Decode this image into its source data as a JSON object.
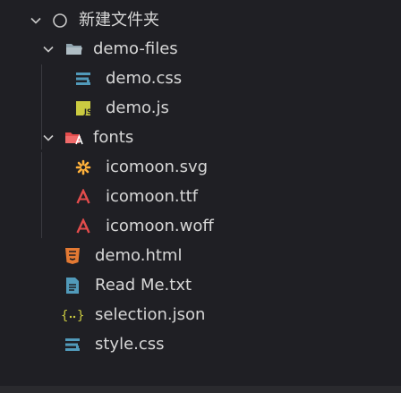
{
  "explorer": {
    "root": {
      "label": "新建文件夹"
    },
    "items": [
      {
        "label": "demo-files"
      },
      {
        "label": "demo.css"
      },
      {
        "label": "demo.js"
      },
      {
        "label": "fonts"
      },
      {
        "label": "icomoon.svg"
      },
      {
        "label": "icomoon.ttf"
      },
      {
        "label": "icomoon.woff"
      },
      {
        "label": "demo.html"
      },
      {
        "label": "Read Me.txt"
      },
      {
        "label": "selection.json"
      },
      {
        "label": "style.css"
      }
    ]
  },
  "icons": {
    "root": "circle-outline-icon",
    "folder_open": "folder-open-icon",
    "folder_fonts": "fonts-folder-icon",
    "css": "css-file-icon",
    "js": "js-file-icon",
    "svg": "svg-file-icon",
    "font": "font-file-icon",
    "html": "html-file-icon",
    "txt": "text-file-icon",
    "json": "json-file-icon"
  },
  "colors": {
    "background": "#1f1f24",
    "text": "#d7d7d7",
    "css": "#519aba",
    "js": "#cbcb41",
    "svg": "#ffb13b",
    "font": "#e34c4c",
    "html": "#e37933",
    "folder": "#90a4ae",
    "guide": "#3a3a40"
  }
}
